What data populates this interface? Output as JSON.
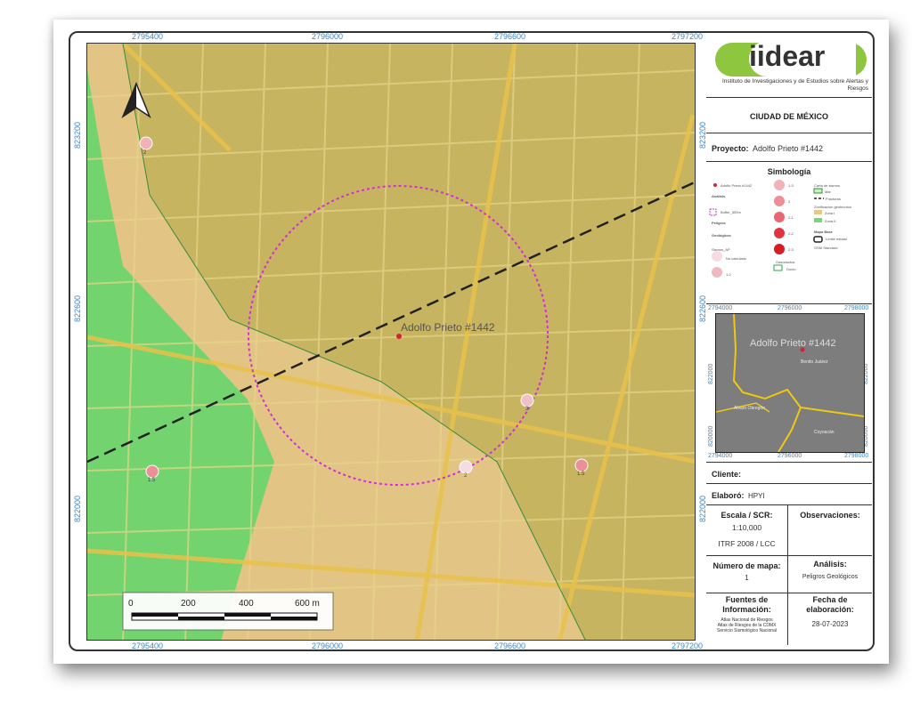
{
  "map": {
    "coords_top": [
      "2795400",
      "2796000",
      "2796600",
      "2797200"
    ],
    "coords_bottom": [
      "2795400",
      "2796000",
      "2796600",
      "2797200"
    ],
    "coords_left": [
      "822000",
      "822600",
      "823200"
    ],
    "coords_right": [
      "822000",
      "822600",
      "823200"
    ],
    "site_label": "Adolfo Prieto #1442",
    "markers": [
      "2",
      "3",
      "1.5",
      "2",
      "1.5"
    ],
    "scale_ticks": [
      "0",
      "200",
      "400",
      "600 m"
    ],
    "colors": {
      "zone_green": "#7ad67a",
      "zone_orange": "#e4c98a",
      "urban": "#c7b461",
      "buffer": "#d030d0"
    }
  },
  "panel": {
    "logo": "iidear",
    "institute": "Instituto de Investigaciones y de Estudios sobre Alertas y Riesgos",
    "city": "CIUDAD DE MÉXICO",
    "project_label": "Proyecto:",
    "project_value": "Adolfo Prieto #1442",
    "legend_title": "Simbología",
    "legend_items": [
      "Adolfo Prieto #1442",
      "Análisis",
      "Buffer_500m",
      "Peligros",
      "Geológicos",
      "Sismos_AP",
      "No calculado",
      "1-2",
      "1-3",
      "2",
      "2-1",
      "2-2",
      "2-3",
      "Gasoductos",
      "Ducto",
      "Carta de sismos",
      "Mar",
      "Fracturas",
      "Zonificación geotécnica",
      "Zona I",
      "Zona II",
      "Mapa Base",
      "Límite estatal",
      "OSM Standard"
    ],
    "inset": {
      "coords_top": [
        "2794000",
        "2796000",
        "2798000"
      ],
      "coords_bottom": [
        "2794000",
        "2796000",
        "2798000"
      ],
      "coords_left": [
        "820000",
        "822000"
      ],
      "coords_right": [
        "820000",
        "822000"
      ],
      "site_label": "Adolfo Prieto #1442",
      "places": [
        "Benito Juárez",
        "Álvaro Obregón",
        "Coyoacán"
      ]
    },
    "client_label": "Cliente:",
    "client_value": "",
    "made_by_label": "Elaboró:",
    "made_by_value": "HPYI",
    "scale_label": "Escala / SCR:",
    "scale_value": "1:10,000",
    "crs_value": "ITRF 2008 / LCC",
    "obs_label": "Observaciones:",
    "map_no_label": "Número de mapa:",
    "map_no_value": "1",
    "analysis_label": "Análisis:",
    "analysis_value": "Peligros Geológicos",
    "sources_label": "Fuentes de Información:",
    "sources_value": "Atlas Nacional de Riesgos\nAtlas de Riesgos de la CDMX\nServicio Sismológico Nacional",
    "date_label": "Fecha de elaboración:",
    "date_value": "28-07-2023"
  }
}
